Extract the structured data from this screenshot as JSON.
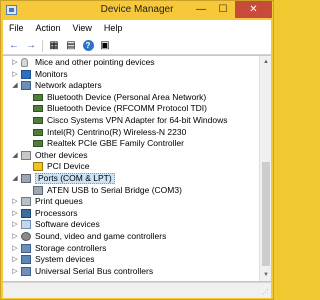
{
  "window": {
    "title": "Device Manager",
    "controls": {
      "minimize": "—",
      "maximize": "☐",
      "close": "✕"
    }
  },
  "menu": [
    "File",
    "Action",
    "View",
    "Help"
  ],
  "toolbar": {
    "buttons": [
      "back-icon",
      "forward-icon",
      "properties-icon",
      "show-hidden-icon",
      "help-icon",
      "scan-icon"
    ],
    "back_glyph": "←",
    "forward_glyph": "→",
    "properties_glyph": "▦",
    "sheet_glyph": "▤",
    "help_glyph": "?",
    "scan_glyph": "▣"
  },
  "tree": [
    {
      "label": "Mice and other pointing devices",
      "level": 1,
      "expander": "▷",
      "icon": "mouse-icon"
    },
    {
      "label": "Monitors",
      "level": 1,
      "expander": "▷",
      "icon": "monitor-icon"
    },
    {
      "label": "Network adapters",
      "level": 1,
      "expander": "◢",
      "icon": "network-icon"
    },
    {
      "label": "Bluetooth Device (Personal Area Network)",
      "level": 2,
      "icon": "network-card-icon"
    },
    {
      "label": "Bluetooth Device (RFCOMM Protocol TDI)",
      "level": 2,
      "icon": "network-card-icon"
    },
    {
      "label": "Cisco Systems VPN Adapter for 64-bit Windows",
      "level": 2,
      "icon": "network-card-icon"
    },
    {
      "label": "Intel(R) Centrino(R) Wireless-N 2230",
      "level": 2,
      "icon": "network-card-icon"
    },
    {
      "label": "Realtek PCIe GBE Family Controller",
      "level": 2,
      "icon": "network-card-icon"
    },
    {
      "label": "Other devices",
      "level": 1,
      "expander": "◢",
      "icon": "other-devices-icon"
    },
    {
      "label": "PCI Device",
      "level": 2,
      "icon": "warning-device-icon"
    },
    {
      "label": "Ports (COM & LPT)",
      "level": 1,
      "expander": "◢",
      "icon": "port-icon",
      "selected": true
    },
    {
      "label": "ATEN USB to Serial Bridge (COM3)",
      "level": 2,
      "icon": "port-icon"
    },
    {
      "label": "Print queues",
      "level": 1,
      "expander": "▷",
      "icon": "printer-icon"
    },
    {
      "label": "Processors",
      "level": 1,
      "expander": "▷",
      "icon": "processor-icon"
    },
    {
      "label": "Software devices",
      "level": 1,
      "expander": "▷",
      "icon": "software-icon"
    },
    {
      "label": "Sound, video and game controllers",
      "level": 1,
      "expander": "▷",
      "icon": "sound-icon"
    },
    {
      "label": "Storage controllers",
      "level": 1,
      "expander": "▷",
      "icon": "storage-icon"
    },
    {
      "label": "System devices",
      "level": 1,
      "expander": "▷",
      "icon": "system-icon"
    },
    {
      "label": "Universal Serial Bus controllers",
      "level": 1,
      "expander": "▷",
      "icon": "usb-icon"
    }
  ],
  "scrollbar": {
    "up_glyph": "▲",
    "down_glyph": "▼"
  },
  "statusbar": {
    "grip_glyph": "⋰"
  },
  "colors": {
    "window_frame": "#f7c93a",
    "close_button": "#c74b3b",
    "selection": "#cde4f7"
  }
}
